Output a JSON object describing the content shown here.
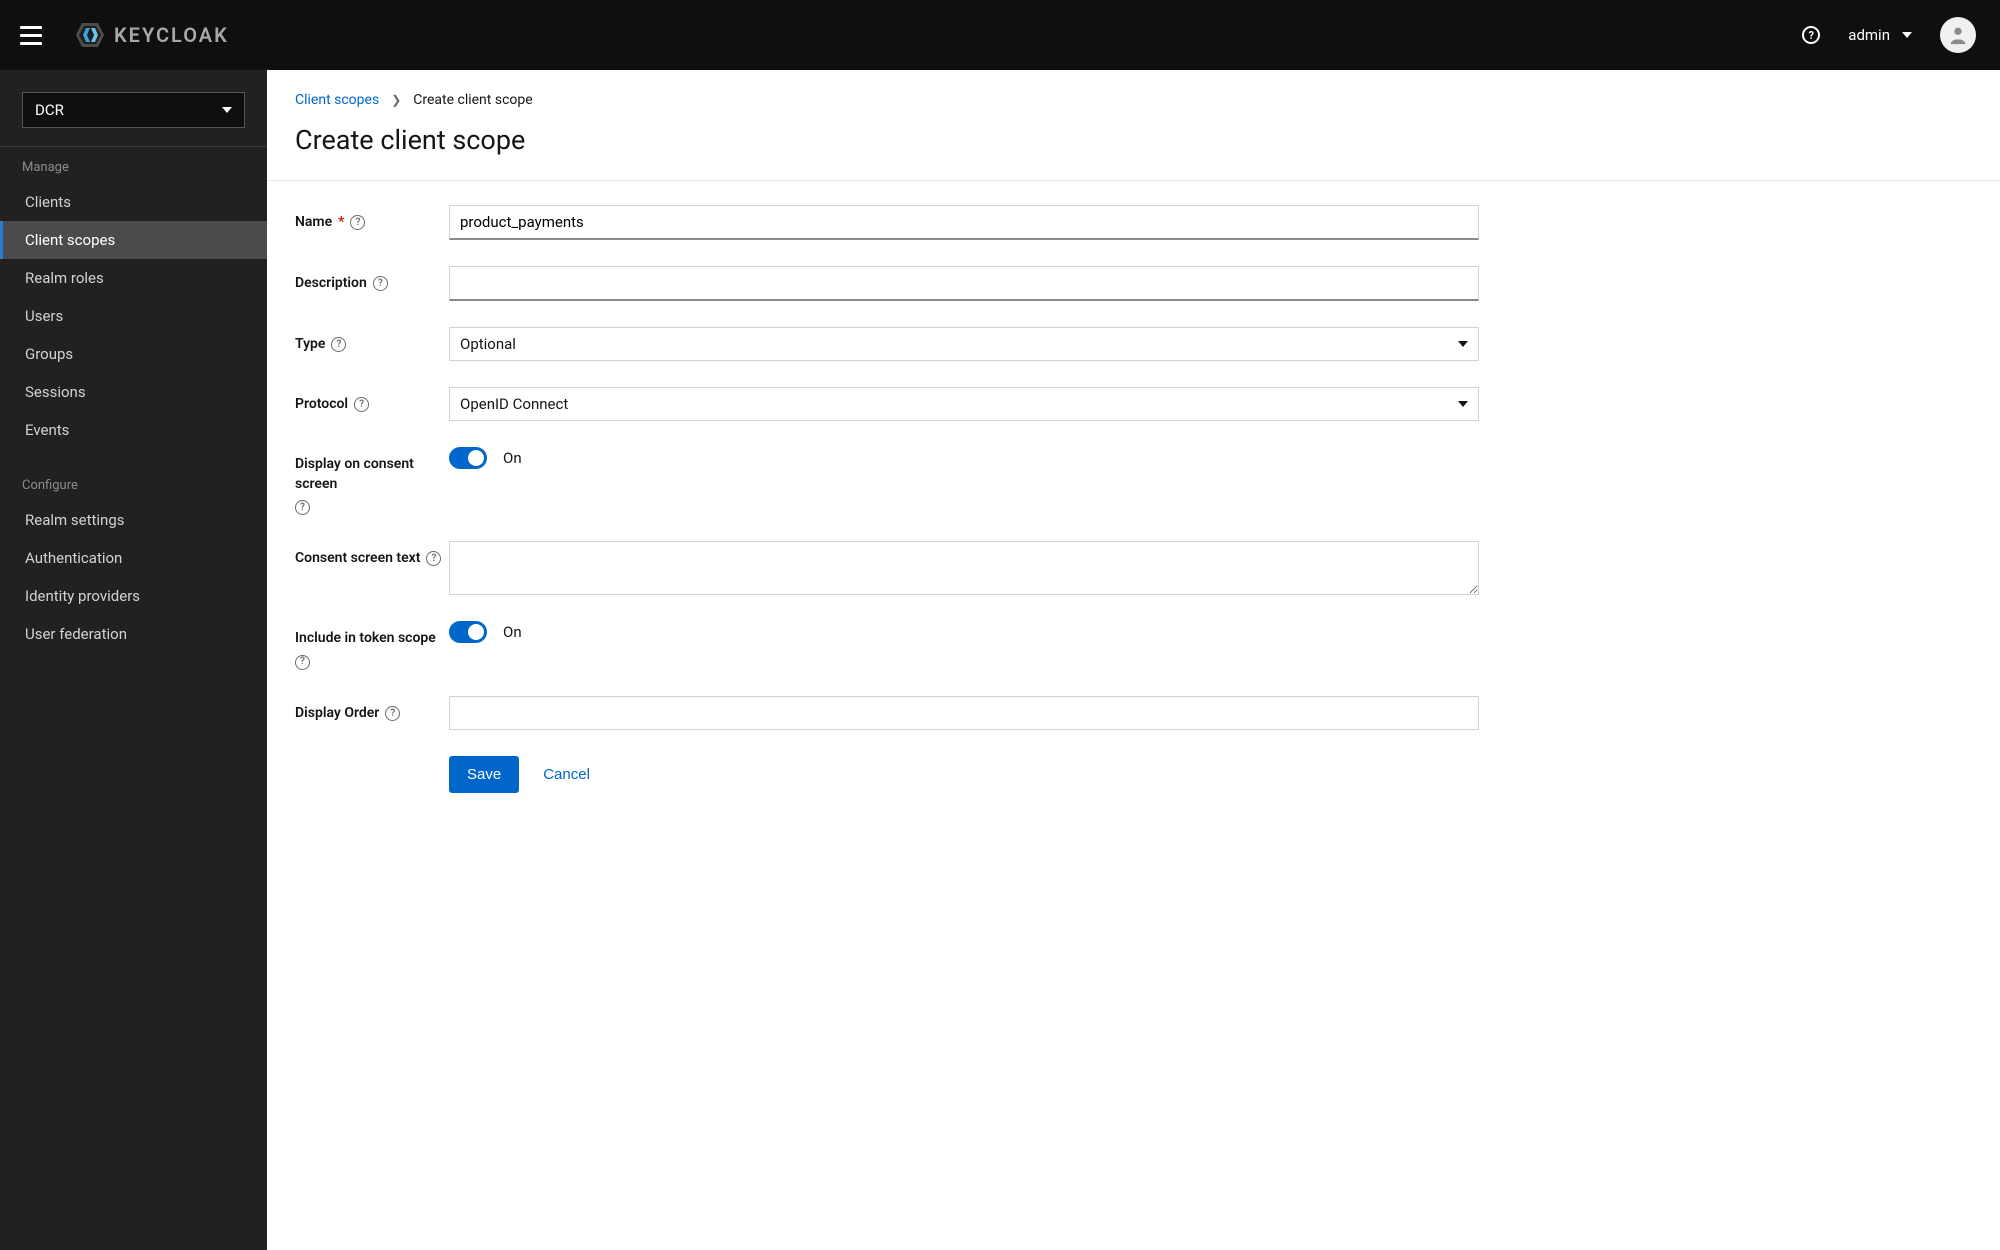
{
  "header": {
    "logo_text": "KEYCLOAK",
    "user_label": "admin"
  },
  "sidebar": {
    "realm_selected": "DCR",
    "section_manage": "Manage",
    "section_configure": "Configure",
    "manage_items": [
      {
        "label": "Clients"
      },
      {
        "label": "Client scopes"
      },
      {
        "label": "Realm roles"
      },
      {
        "label": "Users"
      },
      {
        "label": "Groups"
      },
      {
        "label": "Sessions"
      },
      {
        "label": "Events"
      }
    ],
    "configure_items": [
      {
        "label": "Realm settings"
      },
      {
        "label": "Authentication"
      },
      {
        "label": "Identity providers"
      },
      {
        "label": "User federation"
      }
    ]
  },
  "breadcrumb": {
    "parent": "Client scopes",
    "current": "Create client scope"
  },
  "page": {
    "title": "Create client scope"
  },
  "form": {
    "name_label": "Name",
    "name_value": "product_payments",
    "description_label": "Description",
    "description_value": "",
    "type_label": "Type",
    "type_value": "Optional",
    "protocol_label": "Protocol",
    "protocol_value": "OpenID Connect",
    "display_consent_label": "Display on consent screen",
    "display_consent_state": "On",
    "consent_text_label": "Consent screen text",
    "consent_text_value": "",
    "include_token_label": "Include in token scope",
    "include_token_state": "On",
    "display_order_label": "Display Order",
    "display_order_value": "",
    "save_label": "Save",
    "cancel_label": "Cancel"
  }
}
